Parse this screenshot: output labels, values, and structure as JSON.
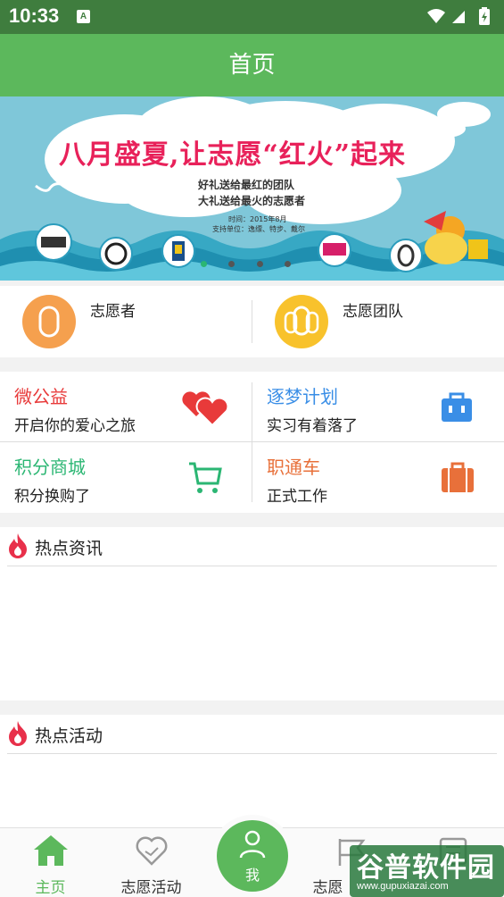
{
  "status_bar": {
    "time": "10:33",
    "notification_icon": "A"
  },
  "header": {
    "title": "首页"
  },
  "banner": {
    "headline": "八月盛夏,让志愿“红火”起来",
    "line1": "好礼送给最红的团队",
    "line2": "大礼送给最火的志愿者",
    "time_text": "时间：2015年8月",
    "sponsor_text": "支持单位：逸缥、特步、戴尔",
    "dot_count": 4,
    "active_dot": 0
  },
  "quick_links": [
    {
      "label": "志愿者",
      "icon": "volunteer-icon",
      "color": "#f5a04e"
    },
    {
      "label": "志愿团队",
      "icon": "team-icon",
      "color": "#f8c22c"
    }
  ],
  "grid": [
    {
      "title": "微公益",
      "subtitle": "开启你的爱心之旅",
      "title_color": "#e83a3a",
      "icon": "hearts-icon"
    },
    {
      "title": "逐梦计划",
      "subtitle": "实习有着落了",
      "title_color": "#3a8ee6",
      "icon": "briefcase-blue-icon"
    },
    {
      "title": "积分商城",
      "subtitle": "积分换购了",
      "title_color": "#2bb673",
      "icon": "cart-icon"
    },
    {
      "title": "职通车",
      "subtitle": "正式工作",
      "title_color": "#e8703a",
      "icon": "briefcase-orange-icon"
    }
  ],
  "sections": {
    "hot_news": {
      "title": "热点资讯"
    },
    "hot_activities": {
      "title": "热点活动"
    }
  },
  "bottom_nav": [
    {
      "label": "主页",
      "icon": "home-icon",
      "active": true
    },
    {
      "label": "志愿活动",
      "icon": "heart-hand-icon",
      "active": false
    },
    {
      "label": "我",
      "icon": "person-icon",
      "active": false
    },
    {
      "label": "志愿",
      "icon": "flag-icon",
      "active": false
    },
    {
      "label": "",
      "icon": "list-icon",
      "active": false
    }
  ],
  "watermark": {
    "text": "谷普软件园",
    "url": "www.gupuxiazai.com"
  },
  "colors": {
    "primary": "#5cb85c",
    "status_bar": "#3f7d3e",
    "accent_red": "#e8215a"
  }
}
